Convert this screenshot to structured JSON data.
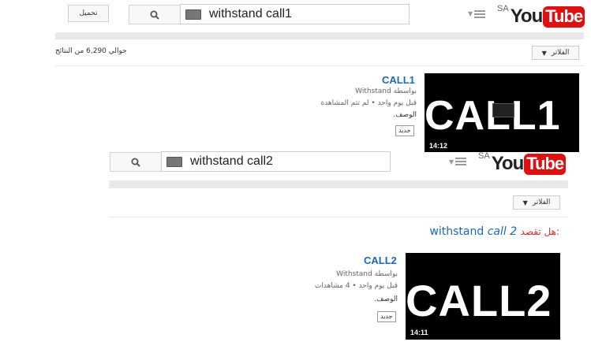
{
  "header1": {
    "logo": {
      "region": "SA",
      "you": "You",
      "tube": "Tube"
    },
    "search_value": "withstand call1",
    "upload_label": "تحميل"
  },
  "results1": {
    "count_text": "حوالي 6,290 من النتائج",
    "filter_label": "الفلاتر",
    "video": {
      "title": "CALL1",
      "by": "بواسطة Withstand",
      "stats": "قبل يوم واحد • لم تتم المشاهدة",
      "description": "الوصف.",
      "badge": "جديد",
      "thumb_text": "CALL1",
      "duration": "14:12"
    }
  },
  "header2": {
    "logo": {
      "region": "SA",
      "you": "You",
      "tube": "Tube"
    },
    "search_value": "withstand call2"
  },
  "results2": {
    "filter_label": "الفلاتر",
    "did_you_mean_prefix": "هل تقصد:",
    "did_you_mean_plain": "withstand",
    "did_you_mean_italic": "call 2",
    "video": {
      "title": "CALL2",
      "by": "بواسطة Withstand",
      "stats": "قبل يوم واحد • 4 مشاهدات",
      "description": "الوصف.",
      "badge": "جديد",
      "thumb_text": "CALL2",
      "duration": "14:11"
    }
  },
  "colors": {
    "link": "#1b67b8",
    "youtube_red": "#dd1111",
    "did_you_mean_prefix": "#cc3333"
  },
  "icons": [
    "menu-icon",
    "search-icon",
    "keyboard-icon",
    "caret-down-icon"
  ]
}
